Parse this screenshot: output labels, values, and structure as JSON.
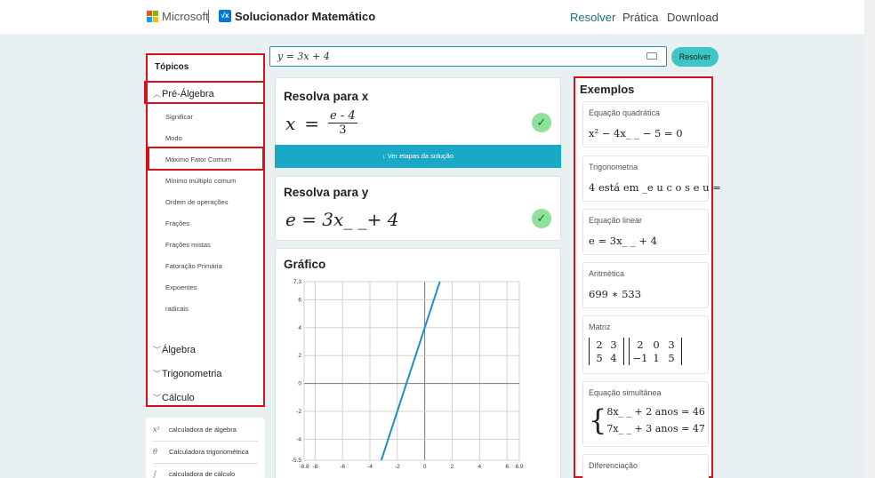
{
  "header": {
    "microsoft": "Microsoft",
    "app_title": "Solucionador Matemático",
    "app_logo": "√x",
    "nav": [
      "Resolver",
      "Prática",
      "Download"
    ]
  },
  "search": {
    "value": "y = 3x + 4",
    "submit_label": "Resolver"
  },
  "topics": {
    "title": "Tópicos",
    "groups": [
      "Pré-Álgebra",
      "Álgebra",
      "Trigonometria",
      "Cálculo"
    ],
    "prealgebra_items": [
      "Significar",
      "Modo",
      "Máximo Fator Comum",
      "Mínimo múltiplo comum",
      "Ordem de operações",
      "Frações",
      "Frações mistas",
      "Fatoração Primária",
      "Expoentes",
      "radicais"
    ]
  },
  "tools": [
    {
      "icon": "x²",
      "label": "calculadora de álgebra"
    },
    {
      "icon": "θ",
      "label": "Calculadora trigonométrica"
    },
    {
      "icon": "∫",
      "label": "calculadora de cálculo"
    }
  ],
  "solutions": {
    "x": {
      "title": "Resolva para x",
      "var": "x",
      "eq": "=",
      "num": "e - 4",
      "den": "3"
    },
    "steps_label": "Ver etapas da solução",
    "y": {
      "title": "Resolva para y",
      "expr": "e = 3x_ _+ 4"
    }
  },
  "graph": {
    "title": "Gráfico"
  },
  "chart_data": {
    "type": "line",
    "title": "Gráfico",
    "xlabel": "",
    "ylabel": "",
    "xlim": [
      -8.8,
      6.9
    ],
    "ylim": [
      -5.5,
      7.3
    ],
    "xticks": [
      "-8.8",
      "-8",
      "-6",
      "-4",
      "-2",
      "0",
      "2",
      "4",
      "6",
      "6.9"
    ],
    "yticks": [
      "7.3",
      "6",
      "4",
      "2",
      "0",
      "-2",
      "-4",
      "-5.5"
    ],
    "series": [
      {
        "x": [
          -3.17,
          1.1
        ],
        "y": [
          -5.5,
          7.3
        ]
      }
    ],
    "grid": true,
    "line_color": "#1f8fbf"
  },
  "examples": {
    "title": "Exemplos",
    "items": [
      {
        "label": "Equação quadrática",
        "math": "x² − 4x_ _ − 5 = 0"
      },
      {
        "label": "Trigonometria",
        "math": "4 está em _e u c o s e u ="
      },
      {
        "label": "Equação linear",
        "math": "e = 3x_ _ + 4"
      },
      {
        "label": "Aritmética",
        "math": "699 ∗ 533"
      },
      {
        "label": "Matriz",
        "m1": [
          [
            "2",
            "3"
          ],
          [
            "5",
            "4"
          ]
        ],
        "m2": [
          [
            "2",
            "0",
            "3"
          ],
          [
            "−1",
            "1",
            "5"
          ]
        ]
      },
      {
        "label": "Equação simultânea",
        "line1": "8x_ _ + 2 anos = 46",
        "line2": "7x_ _ + 3 anos = 47"
      },
      {
        "label": "Diferenciação"
      }
    ]
  },
  "colors": {
    "accent": "#19a9c6",
    "highlight": "#d8101b",
    "check": "#8fe09a",
    "nav_active": "#1f6e7a"
  }
}
